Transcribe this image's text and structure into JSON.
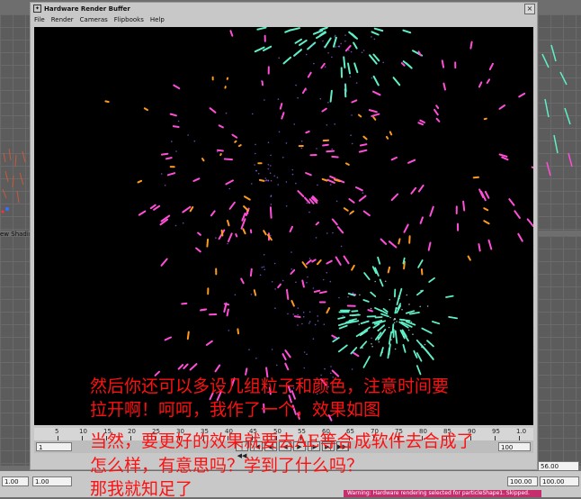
{
  "window": {
    "title": "Hardware Render Buffer",
    "close_glyph": "×",
    "menu": [
      "File",
      "Render",
      "Cameras",
      "Flipbooks",
      "Help"
    ]
  },
  "left_panel": {
    "label": "ew  Shadin"
  },
  "timeline": {
    "ticks": [
      "5",
      "10",
      "15",
      "20",
      "25",
      "30",
      "35",
      "40",
      "45",
      "50",
      "55",
      "60",
      "65",
      "70",
      "75",
      "80",
      "85",
      "90",
      "95",
      "1.0"
    ],
    "start_field": "1",
    "end_field": "100",
    "current_frame_field": "56.00",
    "controls": [
      "|◀◀",
      "|◀",
      "◀|",
      "◀",
      "▶",
      "|▶",
      "▶|",
      "▶▶|"
    ]
  },
  "status_bar": {
    "fields_left": [
      "1.00",
      "1.00"
    ],
    "fields_right": [
      "100.00",
      "100.00"
    ],
    "warning": "Warning: Hardware rendering selected for particleShape1. Skipped."
  },
  "caption": {
    "lines": [
      "然后你还可以多设几组粒子和颜色，注意时间要",
      "拉开啊！呵呵，我作了一个，效果如图",
      "当然，要更好的效果就要去AE等合成软件去合成了",
      "怎么样，有意思吗？学到了什么吗？",
      "那我就知足了"
    ]
  },
  "colors": {
    "firework_cyan": "#5ff0c8",
    "firework_pink": "#ff4fd8",
    "firework_orange": "#ff9a20",
    "firework_purple": "#9a6cff",
    "caption_red": "#ff1010"
  }
}
